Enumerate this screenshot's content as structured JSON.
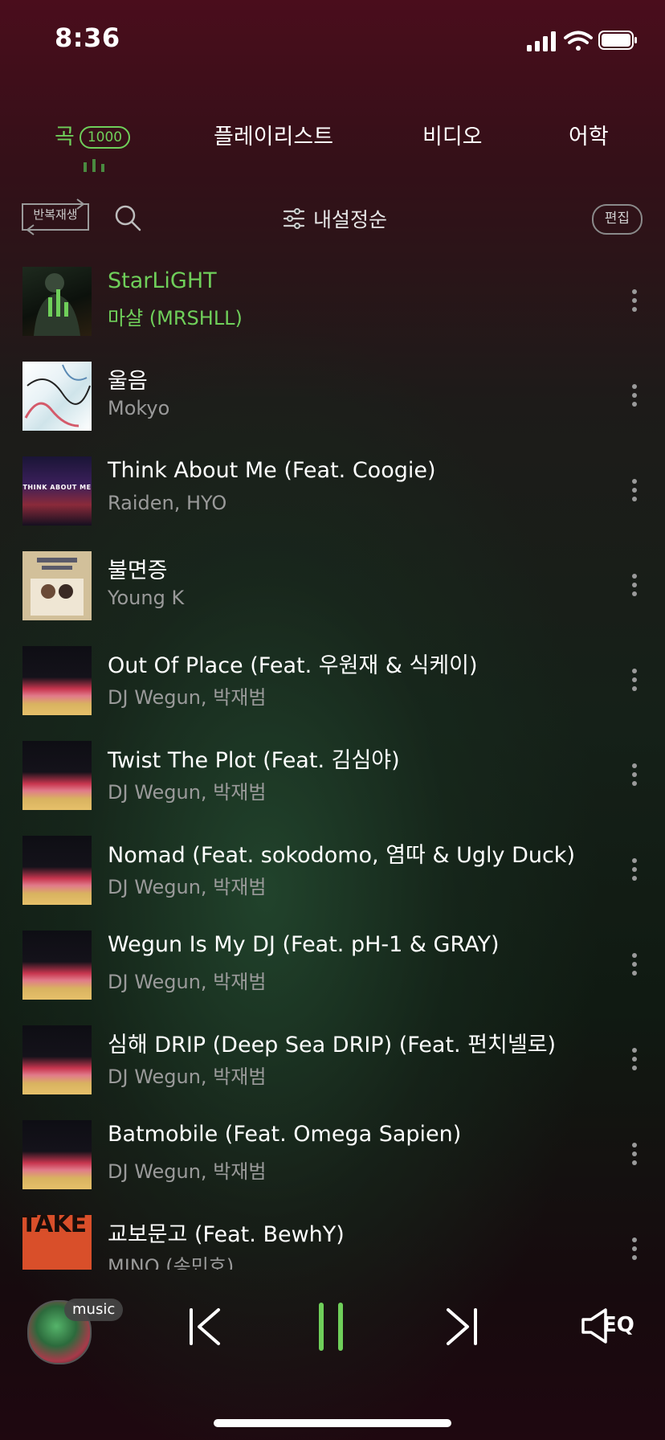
{
  "status_bar": {
    "time": "8:36"
  },
  "tabs": [
    {
      "label": "곡",
      "count": "1000",
      "active": true
    },
    {
      "label": "플레이리스트",
      "active": false
    },
    {
      "label": "비디오",
      "active": false
    },
    {
      "label": "어학",
      "active": false
    }
  ],
  "toolbar": {
    "repeat_label": "반복재생",
    "sort_label": "내설정순",
    "edit_label": "편집"
  },
  "songs": [
    {
      "title": "StarLiGHT",
      "artist": "마샬 (MRSHLL)",
      "playing": true
    },
    {
      "title": "울음",
      "artist": "Mokyo"
    },
    {
      "title": "Think About Me (Feat. Coogie)",
      "artist": "Raiden, HYO"
    },
    {
      "title": "불면증",
      "artist": "Young K"
    },
    {
      "title": "Out Of Place (Feat. 우원재 & 식케이)",
      "artist": "DJ Wegun, 박재범"
    },
    {
      "title": "Twist The Plot (Feat. 김심야)",
      "artist": "DJ Wegun, 박재범"
    },
    {
      "title": "Nomad (Feat. sokodomo, 염따 & Ugly Duck)",
      "artist": "DJ Wegun, 박재범"
    },
    {
      "title": "Wegun Is My DJ (Feat. pH-1 & GRAY)",
      "artist": "DJ Wegun, 박재범"
    },
    {
      "title": "심해 DRIP (Deep Sea DRIP) (Feat. 펀치넬로)",
      "artist": "DJ Wegun, 박재범"
    },
    {
      "title": "Batmobile (Feat. Omega Sapien)",
      "artist": "DJ Wegun, 박재범"
    },
    {
      "title": "교보문고 (Feat. BewhY)",
      "artist": "MINO (송민호)"
    }
  ],
  "covers": {
    "think_about_me_text": "THINK ABOUT ME",
    "take_text": "TAKE"
  },
  "player": {
    "badge": "music",
    "eq_label": "EQ",
    "state": "playing"
  },
  "colors": {
    "accent": "#6fcf5a",
    "secondary_text": "#9a9a9a"
  }
}
